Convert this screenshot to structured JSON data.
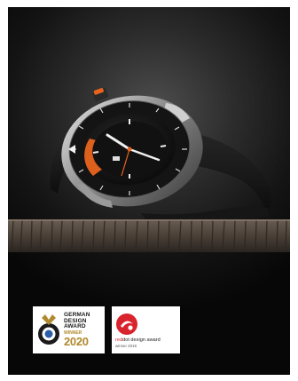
{
  "poster": {
    "background_color": "#101010",
    "accent_color": "#e8641e"
  },
  "german_design_award": {
    "line1": "GERMAN",
    "line2": "DESIGN",
    "line3": "AWARD",
    "winner": "WINNER",
    "year": "2020",
    "gold_color": "#b08a2e"
  },
  "red_dot_award": {
    "brand_red": "red",
    "brand_dot": "dot",
    "label_rest": " design award",
    "sub": "winner 2019",
    "red_color": "#d9232d"
  }
}
